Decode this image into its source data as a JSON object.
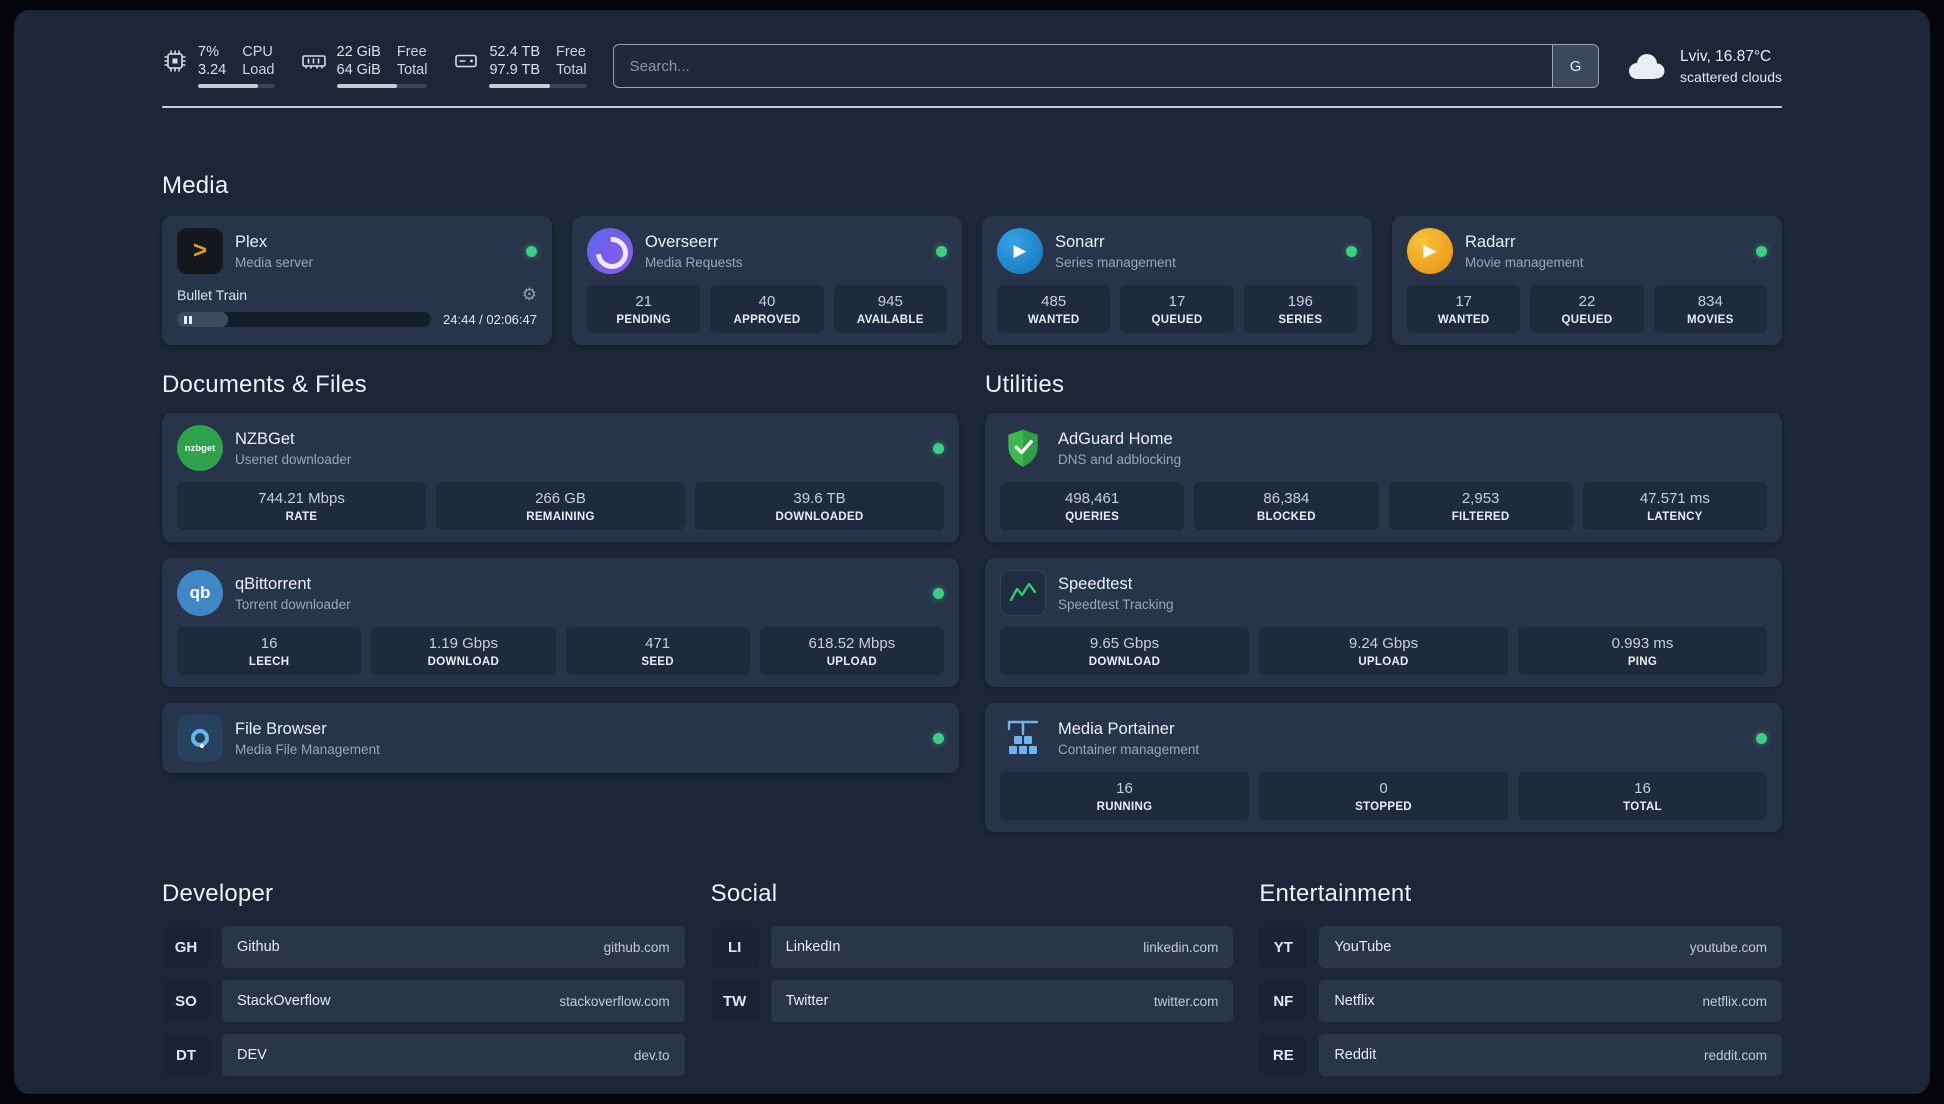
{
  "theme": {
    "page_bg": "#1c2636",
    "card_bg": "#283449",
    "tile_bg": "#1f2a3c",
    "online_green": "#3bd080",
    "plex_amber": "#e5a00d"
  },
  "header": {
    "cpu": {
      "value_top": "7%",
      "value_bottom": "3.24",
      "label_top": "CPU",
      "label_bottom": "Load",
      "progress": 78
    },
    "ram": {
      "value_top": "22 GiB",
      "value_bottom": "64 GiB",
      "label_top": "Free",
      "label_bottom": "Total",
      "progress": 66
    },
    "disk": {
      "value_top": "52.4 TB",
      "value_bottom": "97.9 TB",
      "label_top": "Free",
      "label_bottom": "Total",
      "progress": 62
    },
    "search": {
      "placeholder": "Search...",
      "engine_button": "G"
    },
    "weather": {
      "location": "Lviv, 16.87°C",
      "condition": "scattered clouds"
    }
  },
  "media": {
    "title": "Media",
    "plex": {
      "name": "Plex",
      "subtitle": "Media server",
      "track": "Bullet Train",
      "time": "24:44 / 02:06:47",
      "progress": 20
    },
    "overseerr": {
      "name": "Overseerr",
      "subtitle": "Media Requests",
      "stats": [
        {
          "value": "21",
          "label": "PENDING"
        },
        {
          "value": "40",
          "label": "APPROVED"
        },
        {
          "value": "945",
          "label": "AVAILABLE"
        }
      ]
    },
    "sonarr": {
      "name": "Sonarr",
      "subtitle": "Series management",
      "stats": [
        {
          "value": "485",
          "label": "WANTED"
        },
        {
          "value": "17",
          "label": "QUEUED"
        },
        {
          "value": "196",
          "label": "SERIES"
        }
      ]
    },
    "radarr": {
      "name": "Radarr",
      "subtitle": "Movie management",
      "stats": [
        {
          "value": "17",
          "label": "WANTED"
        },
        {
          "value": "22",
          "label": "QUEUED"
        },
        {
          "value": "834",
          "label": "MOVIES"
        }
      ]
    }
  },
  "documents": {
    "title": "Documents & Files",
    "nzbget": {
      "name": "NZBGet",
      "subtitle": "Usenet downloader",
      "stats": [
        {
          "value": "744.21 Mbps",
          "label": "RATE"
        },
        {
          "value": "266 GB",
          "label": "REMAINING"
        },
        {
          "value": "39.6 TB",
          "label": "DOWNLOADED"
        }
      ]
    },
    "qbittorrent": {
      "name": "qBittorrent",
      "subtitle": "Torrent downloader",
      "stats": [
        {
          "value": "16",
          "label": "LEECH"
        },
        {
          "value": "1.19 Gbps",
          "label": "DOWNLOAD"
        },
        {
          "value": "471",
          "label": "SEED"
        },
        {
          "value": "618.52 Mbps",
          "label": "UPLOAD"
        }
      ]
    },
    "filebrowser": {
      "name": "File Browser",
      "subtitle": "Media File Management"
    }
  },
  "utilities": {
    "title": "Utilities",
    "adguard": {
      "name": "AdGuard Home",
      "subtitle": "DNS and adblocking",
      "stats": [
        {
          "value": "498,461",
          "label": "QUERIES"
        },
        {
          "value": "86,384",
          "label": "BLOCKED"
        },
        {
          "value": "2,953",
          "label": "FILTERED"
        },
        {
          "value": "47.571 ms",
          "label": "LATENCY"
        }
      ]
    },
    "speedtest": {
      "name": "Speedtest",
      "subtitle": "Speedtest Tracking",
      "stats": [
        {
          "value": "9.65 Gbps",
          "label": "DOWNLOAD"
        },
        {
          "value": "9.24 Gbps",
          "label": "UPLOAD"
        },
        {
          "value": "0.993 ms",
          "label": "PING"
        }
      ]
    },
    "portainer": {
      "name": "Media Portainer",
      "subtitle": "Container management",
      "stats": [
        {
          "value": "16",
          "label": "RUNNING"
        },
        {
          "value": "0",
          "label": "STOPPED"
        },
        {
          "value": "16",
          "label": "TOTAL"
        }
      ]
    }
  },
  "bookmarks": {
    "developer": {
      "title": "Developer",
      "links": [
        {
          "abbr": "GH",
          "name": "Github",
          "url": "github.com"
        },
        {
          "abbr": "SO",
          "name": "StackOverflow",
          "url": "stackoverflow.com"
        },
        {
          "abbr": "DT",
          "name": "DEV",
          "url": "dev.to"
        }
      ]
    },
    "social": {
      "title": "Social",
      "links": [
        {
          "abbr": "LI",
          "name": "LinkedIn",
          "url": "linkedin.com"
        },
        {
          "abbr": "TW",
          "name": "Twitter",
          "url": "twitter.com"
        }
      ]
    },
    "entertainment": {
      "title": "Entertainment",
      "links": [
        {
          "abbr": "YT",
          "name": "YouTube",
          "url": "youtube.com"
        },
        {
          "abbr": "NF",
          "name": "Netflix",
          "url": "netflix.com"
        },
        {
          "abbr": "RE",
          "name": "Reddit",
          "url": "reddit.com"
        }
      ]
    }
  },
  "icons": {
    "nzbget_text": "nzbget",
    "qbittorrent_text": "qb"
  }
}
